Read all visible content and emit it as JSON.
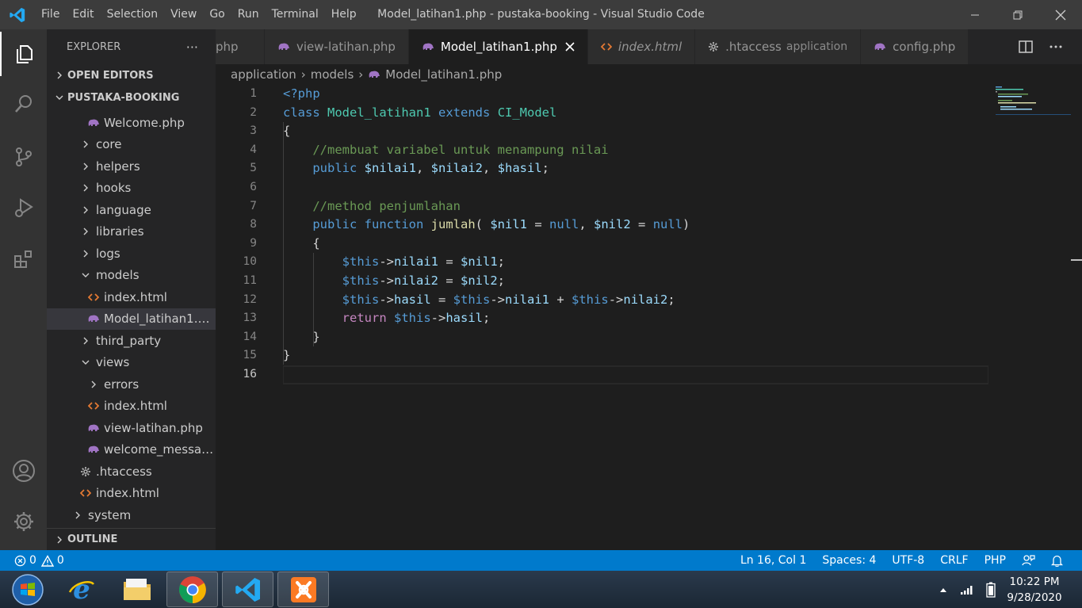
{
  "titlebar": {
    "menu": [
      "File",
      "Edit",
      "Selection",
      "View",
      "Go",
      "Run",
      "Terminal",
      "Help"
    ],
    "window_title": "Model_latihan1.php - pustaka-booking - Visual Studio Code"
  },
  "sidebar": {
    "title": "EXPLORER",
    "more": "···",
    "open_editors": "OPEN EDITORS",
    "project": "PUSTAKA-BOOKING",
    "outline": "OUTLINE",
    "tree": [
      {
        "label": "Welcome.php",
        "type": "php",
        "depth": 3
      },
      {
        "label": "core",
        "type": "folder-closed",
        "depth": 2
      },
      {
        "label": "helpers",
        "type": "folder-closed",
        "depth": 2
      },
      {
        "label": "hooks",
        "type": "folder-closed",
        "depth": 2
      },
      {
        "label": "language",
        "type": "folder-closed",
        "depth": 2
      },
      {
        "label": "libraries",
        "type": "folder-closed",
        "depth": 2
      },
      {
        "label": "logs",
        "type": "folder-closed",
        "depth": 2
      },
      {
        "label": "models",
        "type": "folder-open",
        "depth": 2
      },
      {
        "label": "index.html",
        "type": "html",
        "depth": 3
      },
      {
        "label": "Model_latihan1.php",
        "type": "php",
        "depth": 3,
        "selected": true
      },
      {
        "label": "third_party",
        "type": "folder-closed",
        "depth": 2
      },
      {
        "label": "views",
        "type": "folder-open",
        "depth": 2
      },
      {
        "label": "errors",
        "type": "folder-closed",
        "depth": 3
      },
      {
        "label": "index.html",
        "type": "html",
        "depth": 3
      },
      {
        "label": "view-latihan.php",
        "type": "php",
        "depth": 3
      },
      {
        "label": "welcome_message.php",
        "type": "php",
        "depth": 3
      },
      {
        "label": ".htaccess",
        "type": "gear",
        "depth": 2
      },
      {
        "label": "index.html",
        "type": "html",
        "depth": 2
      },
      {
        "label": "system",
        "type": "folder-closed",
        "depth": 1
      }
    ]
  },
  "tabs": [
    {
      "label": "php",
      "type": "none"
    },
    {
      "label": "view-latihan.php",
      "type": "php"
    },
    {
      "label": "Model_latihan1.php",
      "type": "php",
      "active": true
    },
    {
      "label": "index.html",
      "type": "html",
      "italic": true
    },
    {
      "label": ".htaccess",
      "type": "gear",
      "desc": "application"
    },
    {
      "label": "config.php",
      "type": "php"
    }
  ],
  "breadcrumb": {
    "parts": [
      "application",
      "models"
    ],
    "file": "Model_latihan1.php"
  },
  "editor": {
    "line_numbers": [
      "1",
      "2",
      "3",
      "4",
      "5",
      "6",
      "7",
      "8",
      "9",
      "10",
      "11",
      "12",
      "13",
      "14",
      "15",
      "16"
    ],
    "current_line": 16
  },
  "statusbar": {
    "errors": "0",
    "warnings": "0",
    "position": "Ln 16, Col 1",
    "spaces": "Spaces: 4",
    "encoding": "UTF-8",
    "eol": "CRLF",
    "language": "PHP"
  },
  "taskbar": {
    "time": "10:22 PM",
    "date": "9/28/2020"
  },
  "colors": {
    "accent": "#007acc",
    "php_icon": "#a074c4",
    "html_icon": "#e37933"
  }
}
